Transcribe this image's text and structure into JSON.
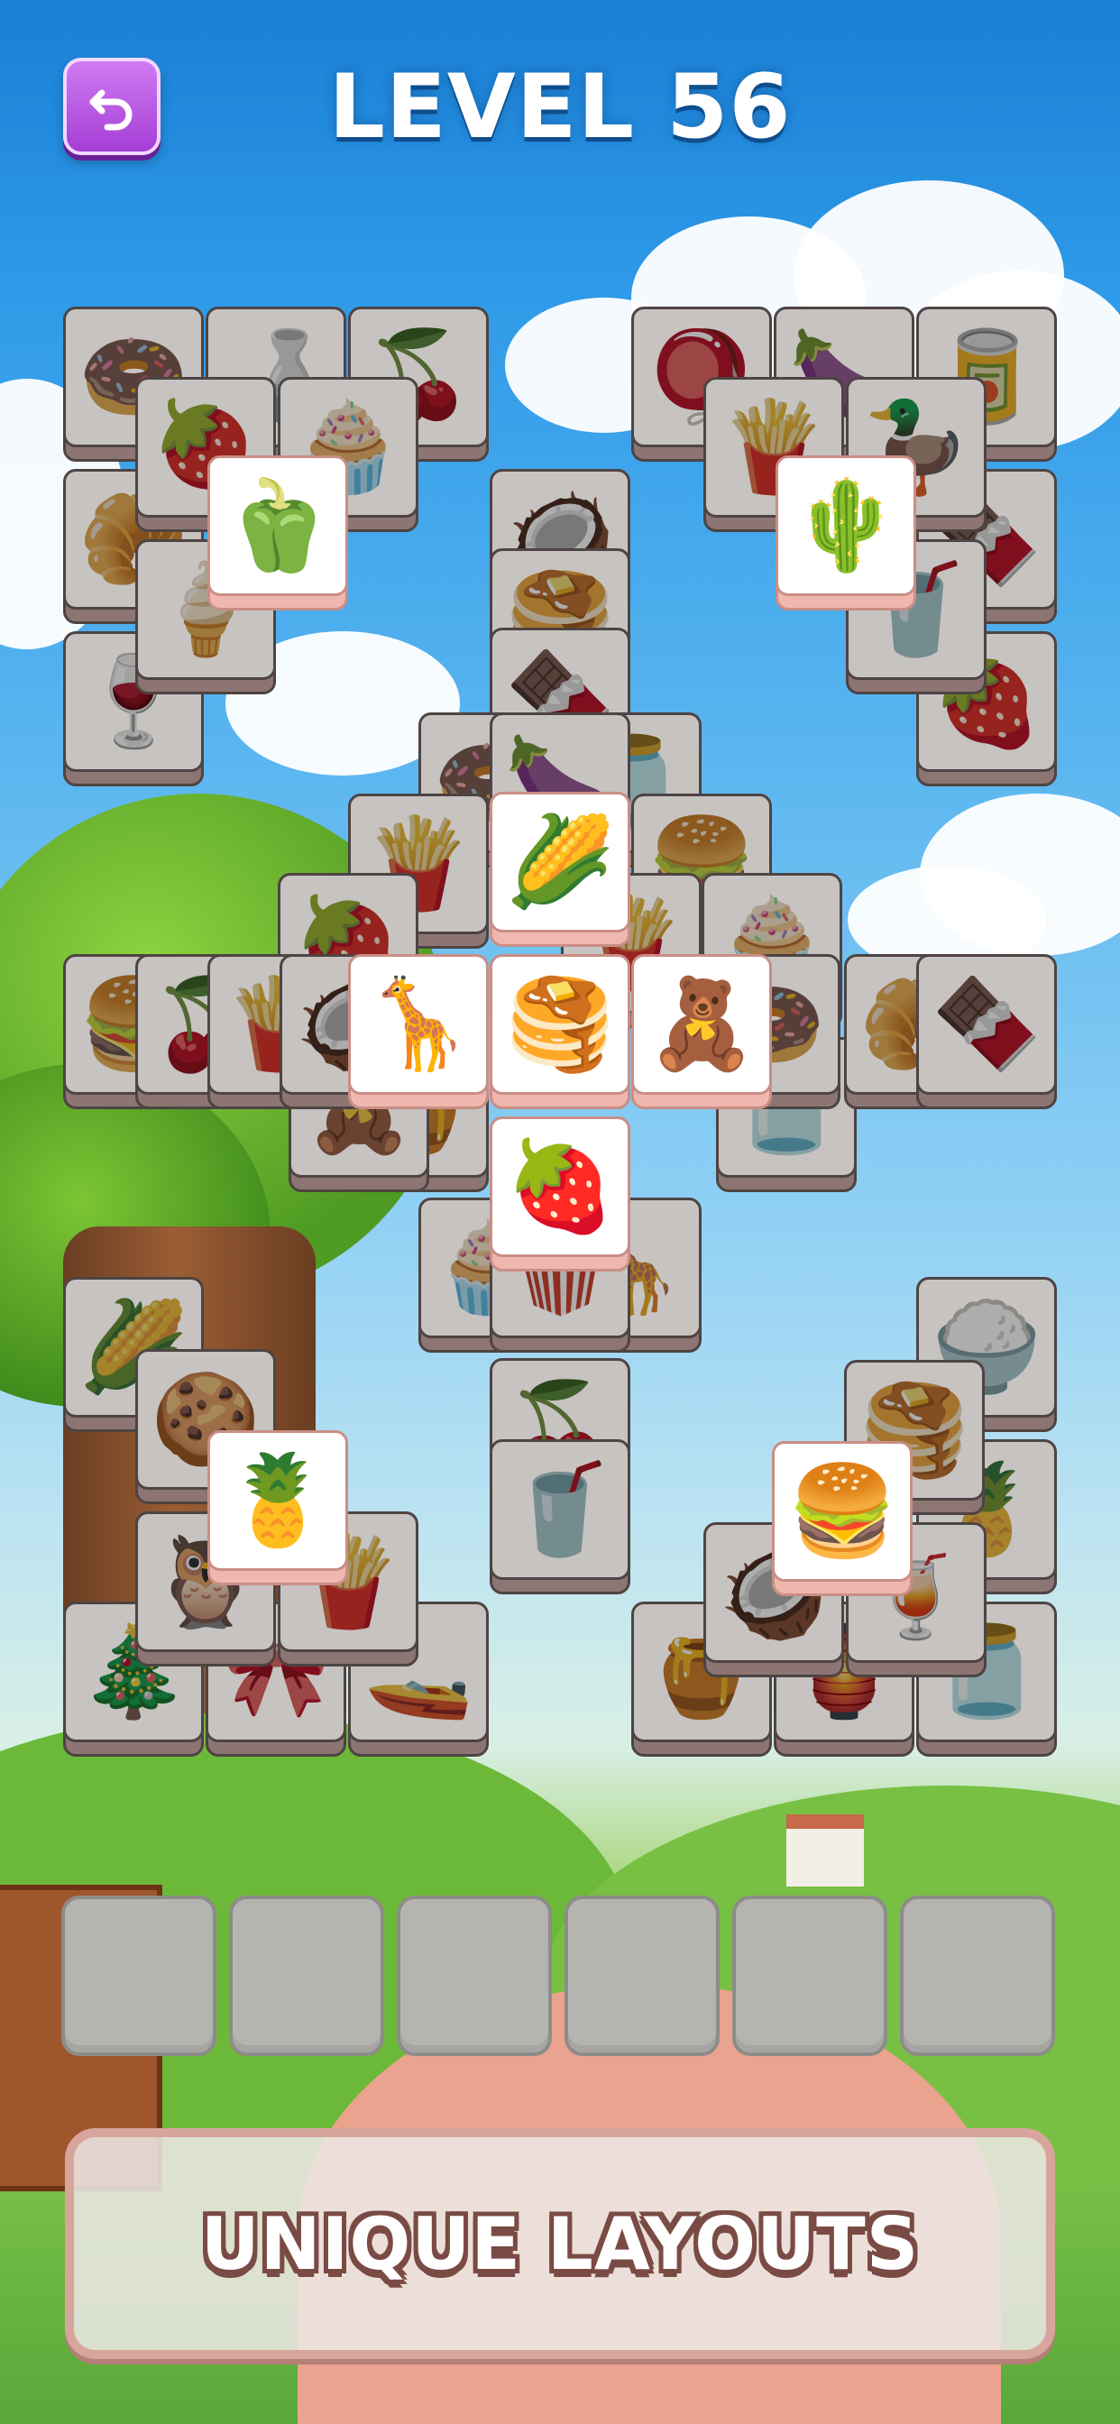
{
  "header": {
    "title": "LEVEL 56",
    "back_icon": "undo-arrow-icon"
  },
  "board": {
    "tiles": [
      {
        "id": "t01",
        "item": "donut",
        "glyph": "🍩",
        "state": "covered"
      },
      {
        "id": "t02",
        "item": "water-bottle",
        "glyph": "🍶",
        "state": "covered"
      },
      {
        "id": "t03",
        "item": "cherry-toast",
        "glyph": "🍒",
        "state": "covered"
      },
      {
        "id": "t04",
        "item": "croissant",
        "glyph": "🥐",
        "state": "covered"
      },
      {
        "id": "t05",
        "item": "jam-jar",
        "glyph": "🍓",
        "state": "covered"
      },
      {
        "id": "t06",
        "item": "cupcake",
        "glyph": "🧁",
        "state": "covered"
      },
      {
        "id": "t07",
        "item": "bell-pepper",
        "glyph": "🫑",
        "state": "free"
      },
      {
        "id": "t08",
        "item": "popsicle",
        "glyph": "🍦",
        "state": "covered"
      },
      {
        "id": "t09",
        "item": "wine-bottle",
        "glyph": "🍷",
        "state": "covered"
      },
      {
        "id": "t10",
        "item": "stacking-toy",
        "glyph": "🪀",
        "state": "covered"
      },
      {
        "id": "t11",
        "item": "eggplant",
        "glyph": "🍆",
        "state": "covered"
      },
      {
        "id": "t12",
        "item": "soda-can",
        "glyph": "🥫",
        "state": "covered"
      },
      {
        "id": "t13",
        "item": "chips-bag",
        "glyph": "🍟",
        "state": "covered"
      },
      {
        "id": "t14",
        "item": "rubber-duck",
        "glyph": "🦆",
        "state": "covered"
      },
      {
        "id": "t15",
        "item": "cactus-pot",
        "glyph": "🌵",
        "state": "free"
      },
      {
        "id": "t16",
        "item": "chocolate-bar",
        "glyph": "🍫",
        "state": "covered"
      },
      {
        "id": "t17",
        "item": "blender",
        "glyph": "🥤",
        "state": "covered"
      },
      {
        "id": "t18",
        "item": "strawberry",
        "glyph": "🍓",
        "state": "covered"
      },
      {
        "id": "t19",
        "item": "coconut-drink",
        "glyph": "🥥",
        "state": "covered"
      },
      {
        "id": "t20",
        "item": "pancakes",
        "glyph": "🥞",
        "state": "covered"
      },
      {
        "id": "t21",
        "item": "chocolate-bar",
        "glyph": "🍫",
        "state": "covered"
      },
      {
        "id": "t22",
        "item": "donut",
        "glyph": "🍩",
        "state": "covered"
      },
      {
        "id": "t23",
        "item": "eggplant",
        "glyph": "🍆",
        "state": "covered"
      },
      {
        "id": "t24",
        "item": "peanut-jar",
        "glyph": "🫙",
        "state": "covered"
      },
      {
        "id": "t25",
        "item": "french-fries",
        "glyph": "🍟",
        "state": "covered"
      },
      {
        "id": "t26",
        "item": "corn",
        "glyph": "🌽",
        "state": "free"
      },
      {
        "id": "t27",
        "item": "burger",
        "glyph": "🍔",
        "state": "covered"
      },
      {
        "id": "t28",
        "item": "jam-jar",
        "glyph": "🍓",
        "state": "covered"
      },
      {
        "id": "t29",
        "item": "chips-bag",
        "glyph": "🍟",
        "state": "covered"
      },
      {
        "id": "t30",
        "item": "cupcake",
        "glyph": "🧁",
        "state": "covered"
      },
      {
        "id": "t31",
        "item": "burger",
        "glyph": "🍔",
        "state": "covered"
      },
      {
        "id": "t32",
        "item": "cherry-toast",
        "glyph": "🍒",
        "state": "covered"
      },
      {
        "id": "t33",
        "item": "chips-bag",
        "glyph": "🍟",
        "state": "covered"
      },
      {
        "id": "t34",
        "item": "coconut",
        "glyph": "🥥",
        "state": "covered"
      },
      {
        "id": "t35",
        "item": "giraffe",
        "glyph": "🦒",
        "state": "free"
      },
      {
        "id": "t36",
        "item": "pancakes",
        "glyph": "🥞",
        "state": "free"
      },
      {
        "id": "t37",
        "item": "teddy-bear",
        "glyph": "🧸",
        "state": "free"
      },
      {
        "id": "t38",
        "item": "donut",
        "glyph": "🍩",
        "state": "covered"
      },
      {
        "id": "t39",
        "item": "croissant",
        "glyph": "🥐",
        "state": "covered"
      },
      {
        "id": "t40",
        "item": "chocolate-bar",
        "glyph": "🍫",
        "state": "covered"
      },
      {
        "id": "t41",
        "item": "teddy-bear",
        "glyph": "🧸",
        "state": "covered"
      },
      {
        "id": "t42",
        "item": "honey-pot",
        "glyph": "🍯",
        "state": "covered"
      },
      {
        "id": "t43",
        "item": "jam-jar",
        "glyph": "🍓",
        "state": "free"
      },
      {
        "id": "t44",
        "item": "cupcake",
        "glyph": "🧁",
        "state": "covered"
      },
      {
        "id": "t45",
        "item": "giraffe",
        "glyph": "🦒",
        "state": "covered"
      },
      {
        "id": "t46",
        "item": "popcorn",
        "glyph": "🍿",
        "state": "covered"
      },
      {
        "id": "t47",
        "item": "peanut-jar",
        "glyph": "🫙",
        "state": "covered"
      },
      {
        "id": "t48",
        "item": "cherry-toast",
        "glyph": "🍒",
        "state": "covered"
      },
      {
        "id": "t49",
        "item": "blender",
        "glyph": "🥤",
        "state": "covered"
      },
      {
        "id": "t50",
        "item": "corn",
        "glyph": "🌽",
        "state": "covered"
      },
      {
        "id": "t51",
        "item": "cookie-jar",
        "glyph": "🍪",
        "state": "covered"
      },
      {
        "id": "t52",
        "item": "pineapple-pot",
        "glyph": "🍍",
        "state": "free"
      },
      {
        "id": "t53",
        "item": "owl",
        "glyph": "🦉",
        "state": "covered"
      },
      {
        "id": "t54",
        "item": "french-fries",
        "glyph": "🍟",
        "state": "covered"
      },
      {
        "id": "t55",
        "item": "christmas-tree",
        "glyph": "🎄",
        "state": "covered"
      },
      {
        "id": "t56",
        "item": "bow",
        "glyph": "🎀",
        "state": "covered"
      },
      {
        "id": "t57",
        "item": "submarine",
        "glyph": "🚤",
        "state": "covered"
      },
      {
        "id": "t58",
        "item": "rice-bowl",
        "glyph": "🍚",
        "state": "covered"
      },
      {
        "id": "t59",
        "item": "pancakes",
        "glyph": "🥞",
        "state": "covered"
      },
      {
        "id": "t60",
        "item": "pineapple",
        "glyph": "🍍",
        "state": "covered"
      },
      {
        "id": "t61",
        "item": "burger",
        "glyph": "🍔",
        "state": "free"
      },
      {
        "id": "t62",
        "item": "coconut",
        "glyph": "🥥",
        "state": "covered"
      },
      {
        "id": "t63",
        "item": "orange-cocktail",
        "glyph": "🍹",
        "state": "covered"
      },
      {
        "id": "t64",
        "item": "honey-pot",
        "glyph": "🍯",
        "state": "covered"
      },
      {
        "id": "t65",
        "item": "peanut-jar",
        "glyph": "🫙",
        "state": "covered"
      },
      {
        "id": "t66",
        "item": "ornament",
        "glyph": "🏮",
        "state": "covered"
      }
    ]
  },
  "tray": {
    "slots": 6,
    "filled": 0
  },
  "banner": {
    "text": "UNIQUE LAYOUTS"
  },
  "colors": {
    "tile_face_free": "#ffffff",
    "tile_side_free": "#efb7ae",
    "tile_face_covered": "#c6c3c1",
    "tile_side_covered": "#8c7572",
    "back_button": "#a53fd6",
    "slot": "#b5b4b1"
  }
}
